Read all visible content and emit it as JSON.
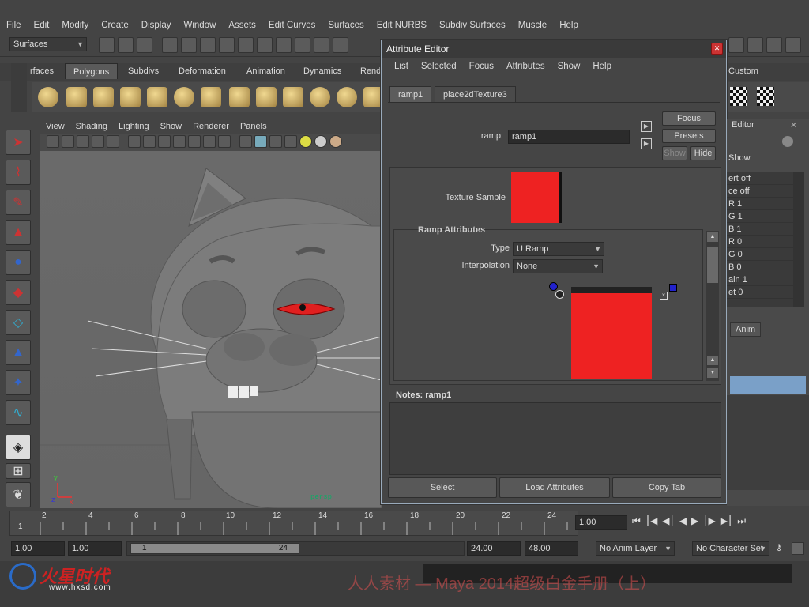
{
  "menubar": [
    "File",
    "Edit",
    "Modify",
    "Create",
    "Display",
    "Window",
    "Assets",
    "Edit Curves",
    "Surfaces",
    "Edit NURBS",
    "Subdiv Surfaces",
    "Muscle",
    "Help"
  ],
  "statusline": {
    "menu_set": "Surfaces"
  },
  "shelf": {
    "tabs": [
      "rfaces",
      "Polygons",
      "Subdivs",
      "Deformation",
      "Animation",
      "Dynamics",
      "Rend"
    ],
    "active": "Polygons",
    "custom_tab": "Custom"
  },
  "viewport": {
    "menu": [
      "View",
      "Shading",
      "Lighting",
      "Show",
      "Renderer",
      "Panels"
    ],
    "corner_label": "persp"
  },
  "attribute_editor": {
    "title": "Attribute Editor",
    "menu": [
      "List",
      "Selected",
      "Focus",
      "Attributes",
      "Show",
      "Help"
    ],
    "tabs": [
      "ramp1",
      "place2dTexture3"
    ],
    "active_tab": "ramp1",
    "node_label": "ramp:",
    "node_name": "ramp1",
    "buttons": {
      "focus": "Focus",
      "presets": "Presets",
      "show": "Show",
      "hide": "Hide"
    },
    "texture_sample_label": "Texture Sample",
    "section_title": "Ramp Attributes",
    "type_label": "Type",
    "type_value": "U Ramp",
    "interp_label": "Interpolation",
    "interp_value": "None",
    "ramp_color": "#ee2222",
    "notes_label": "Notes:  ramp1",
    "bottom_buttons": [
      "Select",
      "Load Attributes",
      "Copy Tab"
    ]
  },
  "channelbox": {
    "editor_label": "Editor",
    "show_label": "Show",
    "rows": [
      "ert off",
      "ce off",
      "R 1",
      "G 1",
      "B 1",
      "R 0",
      "G 0",
      "B 0",
      "ain 1",
      "et 0"
    ],
    "anim_tab": "Anim"
  },
  "timeline": {
    "ticks": [
      "1",
      "2",
      "4",
      "6",
      "8",
      "10",
      "12",
      "14",
      "16",
      "18",
      "20",
      "22",
      "24"
    ],
    "current_time": "1.00"
  },
  "range": {
    "start": "1.00",
    "playback_start": "1.00",
    "slider_start": "1",
    "slider_end": "24",
    "playback_end": "24.00",
    "end": "48.00",
    "anim_layer": "No Anim Layer",
    "character_set": "No Character Set"
  },
  "footer": {
    "logo": "火星时代",
    "logo_url": "www.hxsd.com",
    "watermark": "人人素材 — Maya 2014超级白金手册（上）"
  }
}
